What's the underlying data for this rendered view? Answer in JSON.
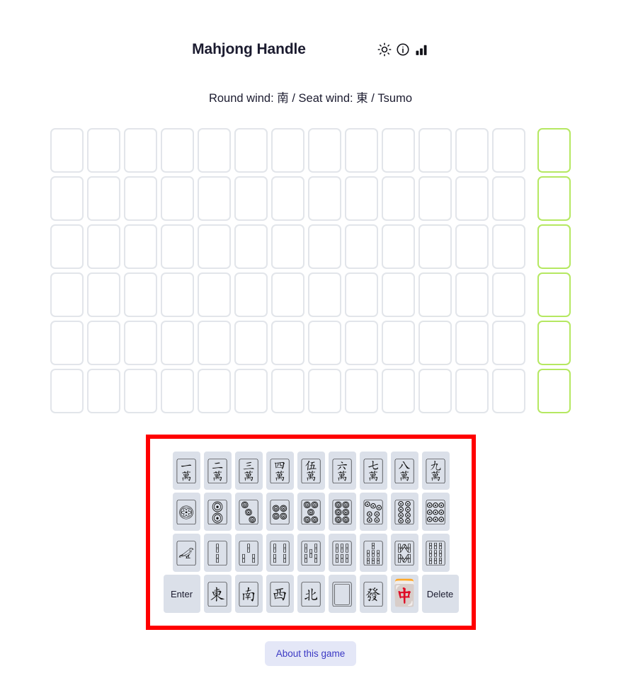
{
  "header": {
    "title": "Mahjong Handle",
    "icons": [
      {
        "name": "sun-icon",
        "label": "Toggle theme"
      },
      {
        "name": "info-icon",
        "label": "Information"
      },
      {
        "name": "bar-chart-icon",
        "label": "Statistics"
      }
    ]
  },
  "status": {
    "line": "Round wind: 南 / Seat wind: 東 / Tsumo",
    "round_wind": "南",
    "seat_wind": "東",
    "win_type": "Tsumo"
  },
  "board": {
    "rows": 6,
    "columns": 14,
    "hand_tiles_per_row": 13,
    "draw_tile_per_row": 1,
    "empty_border_color": "#e2e5ea",
    "draw_border_color": "#b5e861",
    "cells": [
      [
        "",
        "",
        "",
        "",
        "",
        "",
        "",
        "",
        "",
        "",
        "",
        "",
        "",
        ""
      ],
      [
        "",
        "",
        "",
        "",
        "",
        "",
        "",
        "",
        "",
        "",
        "",
        "",
        "",
        ""
      ],
      [
        "",
        "",
        "",
        "",
        "",
        "",
        "",
        "",
        "",
        "",
        "",
        "",
        "",
        ""
      ],
      [
        "",
        "",
        "",
        "",
        "",
        "",
        "",
        "",
        "",
        "",
        "",
        "",
        "",
        ""
      ],
      [
        "",
        "",
        "",
        "",
        "",
        "",
        "",
        "",
        "",
        "",
        "",
        "",
        "",
        ""
      ],
      [
        "",
        "",
        "",
        "",
        "",
        "",
        "",
        "",
        "",
        "",
        "",
        "",
        "",
        ""
      ]
    ]
  },
  "keyboard": {
    "highlight_color": "#ff0000",
    "key_background": "#dbe0e9",
    "rows": [
      [
        {
          "name": "tile-man-1",
          "glyph": "🀇",
          "label": "1 Man"
        },
        {
          "name": "tile-man-2",
          "glyph": "🀈",
          "label": "2 Man"
        },
        {
          "name": "tile-man-3",
          "glyph": "🀉",
          "label": "3 Man"
        },
        {
          "name": "tile-man-4",
          "glyph": "🀊",
          "label": "4 Man"
        },
        {
          "name": "tile-man-5",
          "glyph": "🀋",
          "label": "5 Man"
        },
        {
          "name": "tile-man-6",
          "glyph": "🀌",
          "label": "6 Man"
        },
        {
          "name": "tile-man-7",
          "glyph": "🀍",
          "label": "7 Man"
        },
        {
          "name": "tile-man-8",
          "glyph": "🀎",
          "label": "8 Man"
        },
        {
          "name": "tile-man-9",
          "glyph": "🀏",
          "label": "9 Man"
        }
      ],
      [
        {
          "name": "tile-pin-1",
          "glyph": "🀙",
          "label": "1 Pin"
        },
        {
          "name": "tile-pin-2",
          "glyph": "🀚",
          "label": "2 Pin"
        },
        {
          "name": "tile-pin-3",
          "glyph": "🀛",
          "label": "3 Pin"
        },
        {
          "name": "tile-pin-4",
          "glyph": "🀜",
          "label": "4 Pin"
        },
        {
          "name": "tile-pin-5",
          "glyph": "🀝",
          "label": "5 Pin"
        },
        {
          "name": "tile-pin-6",
          "glyph": "🀞",
          "label": "6 Pin"
        },
        {
          "name": "tile-pin-7",
          "glyph": "🀟",
          "label": "7 Pin"
        },
        {
          "name": "tile-pin-8",
          "glyph": "🀠",
          "label": "8 Pin"
        },
        {
          "name": "tile-pin-9",
          "glyph": "🀡",
          "label": "9 Pin"
        }
      ],
      [
        {
          "name": "tile-sou-1",
          "glyph": "🀐",
          "label": "1 Sou"
        },
        {
          "name": "tile-sou-2",
          "glyph": "🀑",
          "label": "2 Sou"
        },
        {
          "name": "tile-sou-3",
          "glyph": "🀒",
          "label": "3 Sou"
        },
        {
          "name": "tile-sou-4",
          "glyph": "🀓",
          "label": "4 Sou"
        },
        {
          "name": "tile-sou-5",
          "glyph": "🀔",
          "label": "5 Sou"
        },
        {
          "name": "tile-sou-6",
          "glyph": "🀕",
          "label": "6 Sou"
        },
        {
          "name": "tile-sou-7",
          "glyph": "🀖",
          "label": "7 Sou"
        },
        {
          "name": "tile-sou-8",
          "glyph": "🀗",
          "label": "8 Sou"
        },
        {
          "name": "tile-sou-9",
          "glyph": "🀘",
          "label": "9 Sou"
        }
      ],
      [
        {
          "name": "enter-key",
          "glyph": "Enter",
          "label": "Enter",
          "wide": true
        },
        {
          "name": "tile-wind-east",
          "glyph": "🀀",
          "label": "East Wind"
        },
        {
          "name": "tile-wind-south",
          "glyph": "🀁",
          "label": "South Wind"
        },
        {
          "name": "tile-wind-west",
          "glyph": "🀂",
          "label": "West Wind"
        },
        {
          "name": "tile-wind-north",
          "glyph": "🀃",
          "label": "North Wind"
        },
        {
          "name": "tile-dragon-white",
          "glyph": "🀆",
          "label": "White Dragon"
        },
        {
          "name": "tile-dragon-green",
          "glyph": "🀅",
          "label": "Green Dragon"
        },
        {
          "name": "tile-dragon-red",
          "glyph": "🀄",
          "label": "Red Dragon"
        },
        {
          "name": "delete-key",
          "glyph": "Delete",
          "label": "Delete",
          "wide": true
        }
      ]
    ]
  },
  "footer": {
    "about_label": "About this game"
  }
}
